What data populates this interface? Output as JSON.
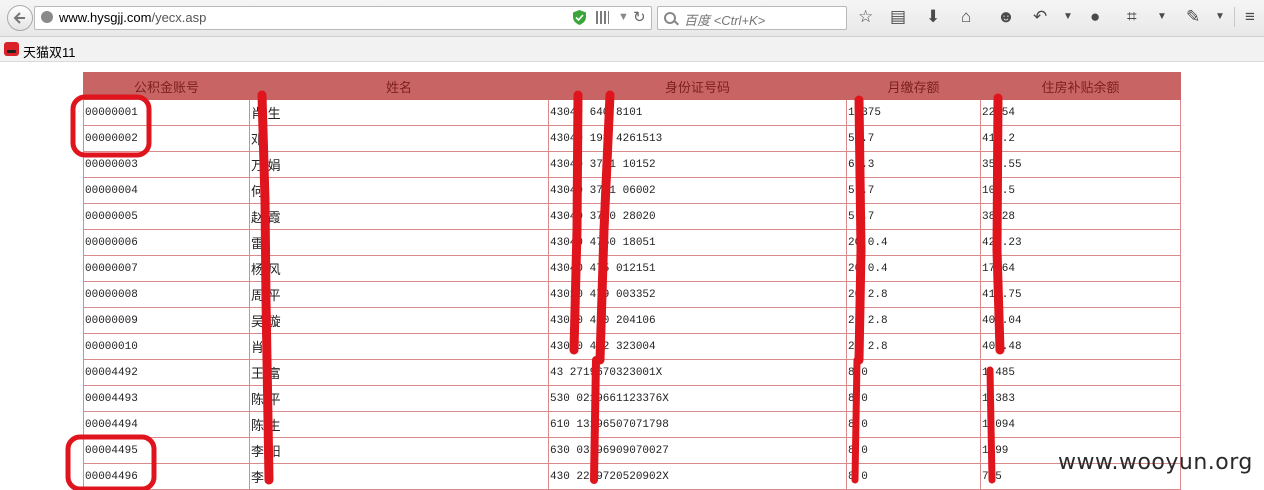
{
  "browser": {
    "url_host": "www.hysgjj.com",
    "url_path": "/yecx.asp",
    "search_placeholder": "百度 <Ctrl+K>"
  },
  "bookmarks": [
    {
      "label": "天猫双11"
    }
  ],
  "table": {
    "headers": [
      "公积金账号",
      "姓名",
      "身份证号码",
      "月缴存额",
      "住房补贴余额"
    ],
    "rows": [
      {
        "account": "00000001",
        "name": "肖 生",
        "id_number": "43040 640  8101",
        "monthly": "1  375",
        "balance": "22  54"
      },
      {
        "account": "00000002",
        "name": "邓 ",
        "id_number": "43040  198  4261513",
        "monthly": "5  .7",
        "balance": "41  .2"
      },
      {
        "account": "00000003",
        "name": "万  娟",
        "id_number": "43040 3771  10152",
        "monthly": "6  .3",
        "balance": "35  .55"
      },
      {
        "account": "00000004",
        "name": "何 ",
        "id_number": "43040 3781  06002",
        "monthly": "5  .7",
        "balance": "10  .5"
      },
      {
        "account": "00000005",
        "name": "赵  霞",
        "id_number": "43040 3780  28020",
        "monthly": "5  .7",
        "balance": "38 28"
      },
      {
        "account": "00000006",
        "name": "雷 ",
        "id_number": "43040 4760 18051",
        "monthly": "20 0.4",
        "balance": "42  .23"
      },
      {
        "account": "00000007",
        "name": "杨  风",
        "id_number": "43040 475  012151",
        "monthly": "20 0.4",
        "balance": "17 64"
      },
      {
        "account": "00000008",
        "name": "周  平",
        "id_number": "43010 479  003352",
        "monthly": "20 2.8",
        "balance": "41  .75"
      },
      {
        "account": "00000009",
        "name": "吴  璇",
        "id_number": "43040 480  204106",
        "monthly": "20 2.8",
        "balance": "40  .04"
      },
      {
        "account": "00000010",
        "name": "肖 ",
        "id_number": "43040 482  323004",
        "monthly": "20 2.8",
        "balance": "40  .48"
      },
      {
        "account": "00004492",
        "name": "王  富",
        "id_number": "43  2719670323001X",
        "monthly": "8  0",
        "balance": "1  485"
      },
      {
        "account": "00004493",
        "name": "陈  平",
        "id_number": "530  0219661123376X",
        "monthly": "8  0",
        "balance": "1  383"
      },
      {
        "account": "00004494",
        "name": "陈  生",
        "id_number": "610  13196507071798",
        "monthly": "8  0",
        "balance": "1  094"
      },
      {
        "account": "00004495",
        "name": "李  阳",
        "id_number": "630  03196909070027",
        "monthly": "8  0",
        "balance": "1  99"
      },
      {
        "account": "00004496",
        "name": "李 ",
        "id_number": "430  2219720520902X",
        "monthly": "8  0",
        "balance": "7  5"
      }
    ]
  },
  "watermark": "www.wooyun.org"
}
